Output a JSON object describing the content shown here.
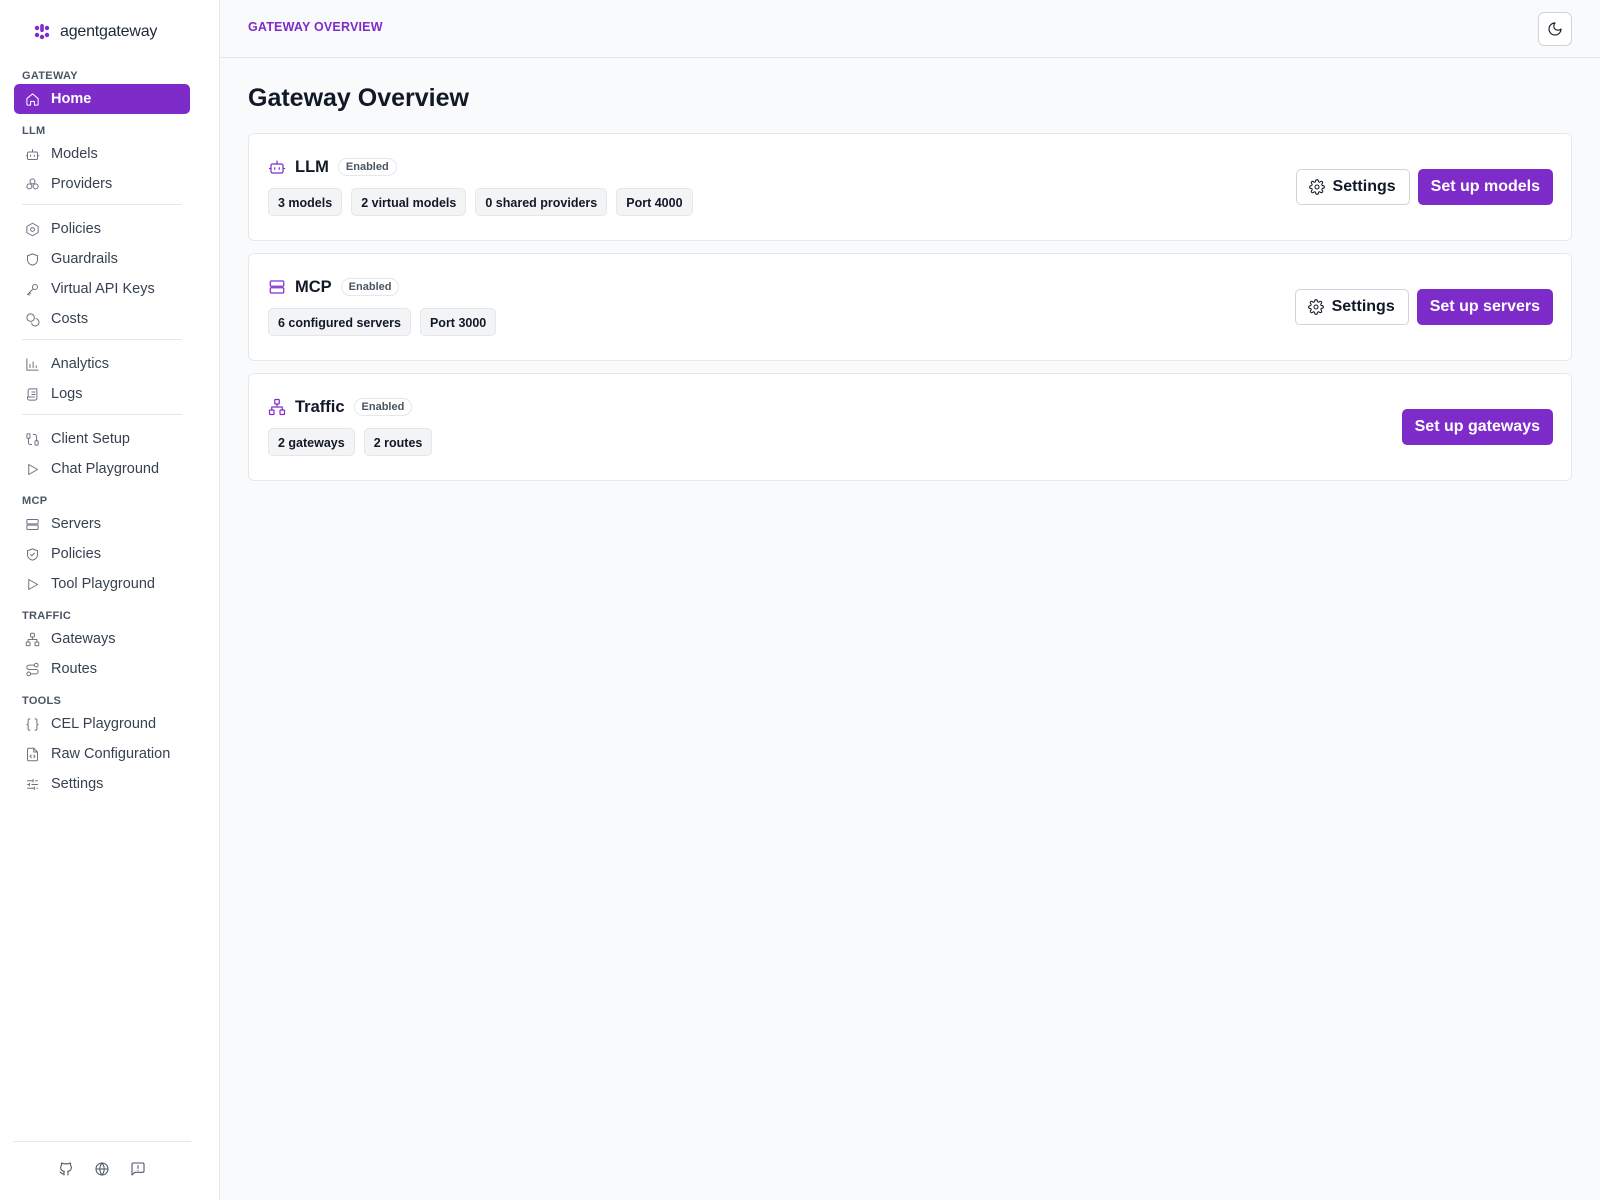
{
  "app": {
    "logo_text": "agentgateway"
  },
  "sidebar": {
    "sections": [
      {
        "label": "GATEWAY"
      },
      {
        "label": "LLM"
      },
      {
        "label": "MCP"
      },
      {
        "label": "TRAFFIC"
      },
      {
        "label": "TOOLS"
      }
    ],
    "items": [
      {
        "label": "Home",
        "icon": "home-icon",
        "active": true
      },
      {
        "label": "Models",
        "icon": "bot-icon"
      },
      {
        "label": "Providers",
        "icon": "boxes-icon"
      },
      {
        "label": "Policies",
        "icon": "hexagon-icon"
      },
      {
        "label": "Guardrails",
        "icon": "shield-icon"
      },
      {
        "label": "Virtual API Keys",
        "icon": "key-icon"
      },
      {
        "label": "Costs",
        "icon": "coins-icon"
      },
      {
        "label": "Analytics",
        "icon": "bar-chart-icon"
      },
      {
        "label": "Logs",
        "icon": "scroll-icon"
      },
      {
        "label": "Client Setup",
        "icon": "cable-icon"
      },
      {
        "label": "Chat Playground",
        "icon": "play-icon"
      },
      {
        "label": "Servers",
        "icon": "server-icon"
      },
      {
        "label": "Policies",
        "icon": "shield-check-icon"
      },
      {
        "label": "Tool Playground",
        "icon": "play-icon"
      },
      {
        "label": "Gateways",
        "icon": "network-icon"
      },
      {
        "label": "Routes",
        "icon": "route-icon"
      },
      {
        "label": "CEL Playground",
        "icon": "braces-icon"
      },
      {
        "label": "Raw Configuration",
        "icon": "file-code-icon"
      },
      {
        "label": "Settings",
        "icon": "sliders-icon"
      }
    ],
    "footer_icons": [
      "github-icon",
      "globe-icon",
      "feedback-icon"
    ]
  },
  "header": {
    "breadcrumb": "GATEWAY OVERVIEW",
    "theme_toggle_icon": "moon-icon"
  },
  "main": {
    "title": "Gateway Overview",
    "cards": [
      {
        "title": "LLM",
        "icon": "bot-icon",
        "badge": "Enabled",
        "chips": [
          "3 models",
          "2 virtual models",
          "0 shared providers",
          "Port 4000"
        ],
        "settings_label": "Settings",
        "primary_label": "Set up models"
      },
      {
        "title": "MCP",
        "icon": "server-icon",
        "badge": "Enabled",
        "chips": [
          "6 configured servers",
          "Port 3000"
        ],
        "settings_label": "Settings",
        "primary_label": "Set up servers"
      },
      {
        "title": "Traffic",
        "icon": "network-icon",
        "badge": "Enabled",
        "chips": [
          "2 gateways",
          "2 routes"
        ],
        "primary_label": "Set up gateways"
      }
    ]
  },
  "colors": {
    "accent": "#7e2cc9",
    "background": "#f9fafb",
    "card": "#ffffff",
    "border": "#e5e7eb"
  }
}
